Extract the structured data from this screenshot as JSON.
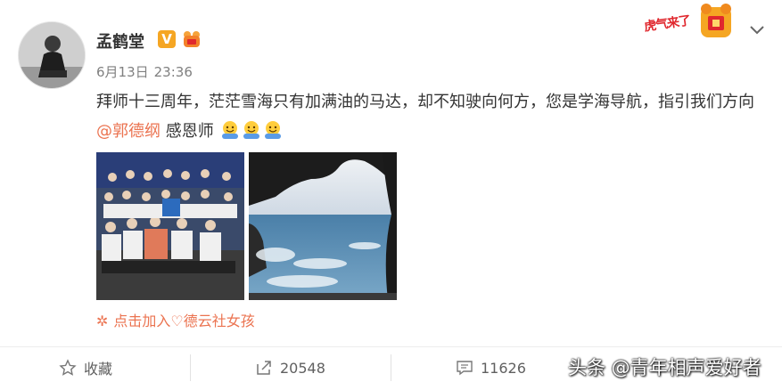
{
  "post": {
    "author": "孟鹤堂",
    "verified_badge": "V",
    "date": "6月13日",
    "time": "23:36",
    "text_before_mention": "拜师十三周年，茫茫雪海只有加满油的马达，却不知驶向何方，您是学海导航，指引我们方向",
    "mention": "@郭德纲",
    "text_after_mention": " 感恩师",
    "emoji_count": 3,
    "emoji_icon": "hug-emoji-icon",
    "images": [
      {
        "name": "group-photo",
        "description_icon": "group-photo-image"
      },
      {
        "name": "sea-photo",
        "description_icon": "sea-cave-image"
      }
    ],
    "source": "点击加入♡德云社女孩"
  },
  "stamp": {
    "text": "虎气来了"
  },
  "actions": {
    "favorite_label": "收藏",
    "repost_count": "20548",
    "comment_count": "11626"
  },
  "watermark": "头条 @青年相声爱好者",
  "colors": {
    "accent": "#eb7350",
    "verified": "#f5a623",
    "stamp_red": "#e0282e"
  }
}
